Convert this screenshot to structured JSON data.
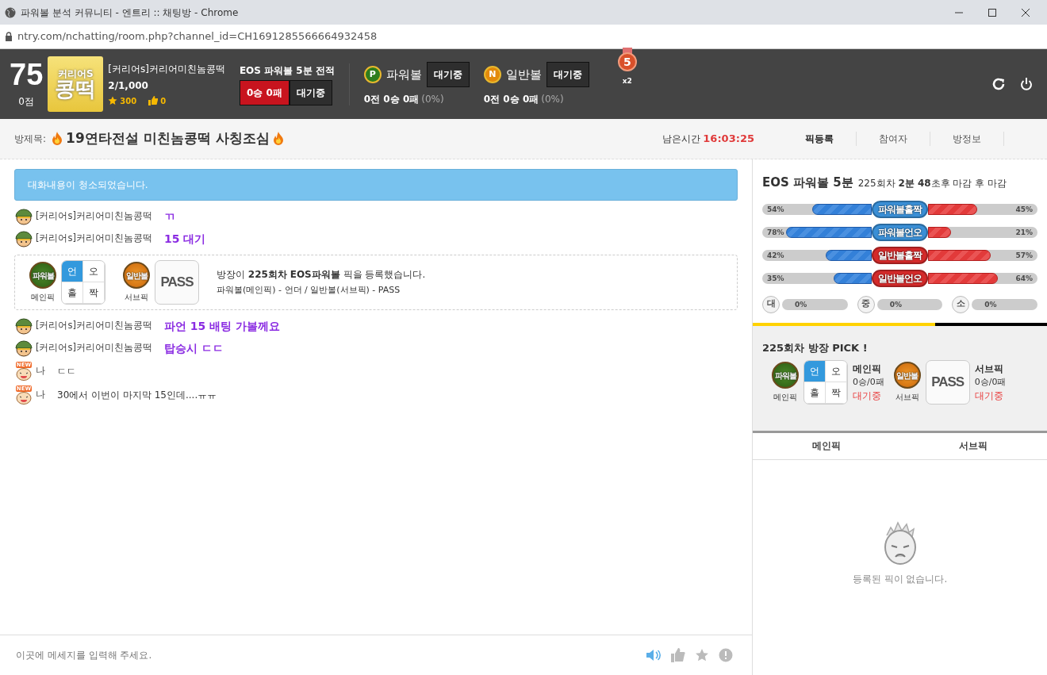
{
  "window": {
    "title": "파워볼 분석 커뮤니티 - 엔트리 :: 채팅방 - Chrome",
    "url": "ntry.com/nchatting/room.php?channel_id=CH1691285566664932458"
  },
  "header": {
    "score": "75",
    "points": "0점",
    "logo": [
      "커리어S",
      "콩떡"
    ],
    "user": {
      "name": "[커리어s]커리어미친놈콩떡",
      "members": "2/1,000",
      "stars": "300",
      "likes": "0"
    },
    "record": {
      "title": "EOS 파워볼 5분 전적",
      "result": "0승 0패",
      "status": "대기중"
    },
    "games": [
      {
        "kind": "powerball",
        "badge": "P",
        "name": "파워볼",
        "status": "대기중",
        "stats": "0전 0승 0패",
        "rate": "(0%)"
      },
      {
        "kind": "normal",
        "badge": "N",
        "name": "일반볼",
        "status": "대기중",
        "stats": "0전 0승 0패",
        "rate": "(0%)"
      }
    ],
    "medal": {
      "number": "5",
      "count": "x2"
    }
  },
  "room": {
    "label": "방제목:",
    "title": "19연타전설 미친놈콩떡 사칭조심",
    "time_label": "남은시간",
    "time": "16:03:25",
    "tabs": [
      {
        "label": "픽등록",
        "selected": true
      },
      {
        "label": "참여자",
        "selected": false
      },
      {
        "label": "방정보",
        "selected": false
      }
    ]
  },
  "chat": {
    "notice": "대화내용이 청소되었습니다.",
    "items": [
      {
        "kind": "message",
        "avatar": {
          "kind": "soldier"
        },
        "name": "[커리어s]커리어미친놈콩떡",
        "text": "ㄲ",
        "highlight": true
      },
      {
        "kind": "message",
        "avatar": {
          "kind": "soldier"
        },
        "name": "[커리어s]커리어미친놈콩떡",
        "text": "15 대기",
        "highlight": true
      },
      {
        "kind": "pick",
        "picks": [
          {
            "ball": {
              "kind": "powerball",
              "label": "파워볼"
            },
            "label": "메인픽",
            "grid": {
              "kind": "cells",
              "cells": [
                {
                  "label": "언",
                  "selected": true
                },
                {
                  "label": "오",
                  "selected": false
                },
                {
                  "label": "홀",
                  "selected": false
                },
                {
                  "label": "짝",
                  "selected": false
                }
              ]
            }
          },
          {
            "ball": {
              "kind": "normal",
              "label": "일반볼"
            },
            "label": "서브픽",
            "grid": {
              "kind": "pass",
              "label": "PASS"
            }
          }
        ],
        "message": "방장이 **225회차** **EOS파워볼** 픽을 등록했습니다.",
        "detail": "파워볼(메인픽) - 언더 / 일반볼(서브픽) - PASS"
      },
      {
        "kind": "message",
        "avatar": {
          "kind": "soldier"
        },
        "name": "[커리어s]커리어미친놈콩떡",
        "text": "파언 15 배팅 가볼께요",
        "highlight": true
      },
      {
        "kind": "message",
        "avatar": {
          "kind": "soldier"
        },
        "name": "[커리어s]커리어미친놈콩떡",
        "text": "탑승시 ㄷㄷ",
        "highlight": true
      },
      {
        "kind": "message",
        "avatar": {
          "kind": "new",
          "tag": "NEW"
        },
        "name": "나",
        "text": "ㄷㄷ",
        "highlight": false
      },
      {
        "kind": "message",
        "avatar": {
          "kind": "new",
          "tag": "NEW"
        },
        "name": "나",
        "text": "30에서 이번이 마지막 15인데....ㅠㅠ",
        "highlight": false
      }
    ],
    "input": {
      "placeholder": "이곳에 메세지를 입력해 주세요."
    }
  },
  "round_panel": {
    "title": "EOS 파워볼 5분",
    "subtitle": "225회차 **2분 48**초후 마감 후 마감",
    "bars": [
      {
        "label": "파워볼홀짝",
        "color": "#3a8fd6",
        "left": {
          "reading": "54%",
          "level": 0.54
        },
        "right": {
          "reading": "45%",
          "level": 0.45
        }
      },
      {
        "label": "파워볼언오",
        "color": "#3a8fd6",
        "left": {
          "reading": "78%",
          "level": 0.78
        },
        "right": {
          "reading": "21%",
          "level": 0.21
        }
      },
      {
        "label": "일반볼홀짝",
        "color": "#d42a2a",
        "left": {
          "reading": "42%",
          "level": 0.42
        },
        "right": {
          "reading": "57%",
          "level": 0.57
        }
      },
      {
        "label": "일반볼언오",
        "color": "#d42a2a",
        "left": {
          "reading": "35%",
          "level": 0.35
        },
        "right": {
          "reading": "64%",
          "level": 0.64
        }
      }
    ],
    "sizes": [
      {
        "label": "대",
        "reading": "0%",
        "level": 0
      },
      {
        "label": "중",
        "reading": "0%",
        "level": 0
      },
      {
        "label": "소",
        "reading": "0%",
        "level": 0
      }
    ],
    "progress": {
      "level": 0.62
    }
  },
  "pick_panel": {
    "title": "225회차 방장 PICK !",
    "picks": [
      {
        "ball": {
          "kind": "powerball",
          "label": "파워볼"
        },
        "label": "메인픽",
        "grid": {
          "kind": "cells",
          "cells": [
            {
              "label": "언",
              "selected": true
            },
            {
              "label": "오",
              "selected": false
            },
            {
              "label": "홀",
              "selected": false
            },
            {
              "label": "짝",
              "selected": false
            }
          ]
        },
        "name": "메인픽",
        "record": "0승/0패",
        "status": "대기중"
      },
      {
        "ball": {
          "kind": "normal",
          "label": "일반볼"
        },
        "label": "서브픽",
        "grid": {
          "kind": "pass",
          "label": "PASS"
        },
        "name": "서브픽",
        "record": "0승/0패",
        "status": "대기중"
      }
    ]
  },
  "pick_tabs": [
    {
      "label": "메인픽"
    },
    {
      "label": "서브픽"
    }
  ],
  "empty": {
    "text": "등록된 픽이 없습니다."
  }
}
